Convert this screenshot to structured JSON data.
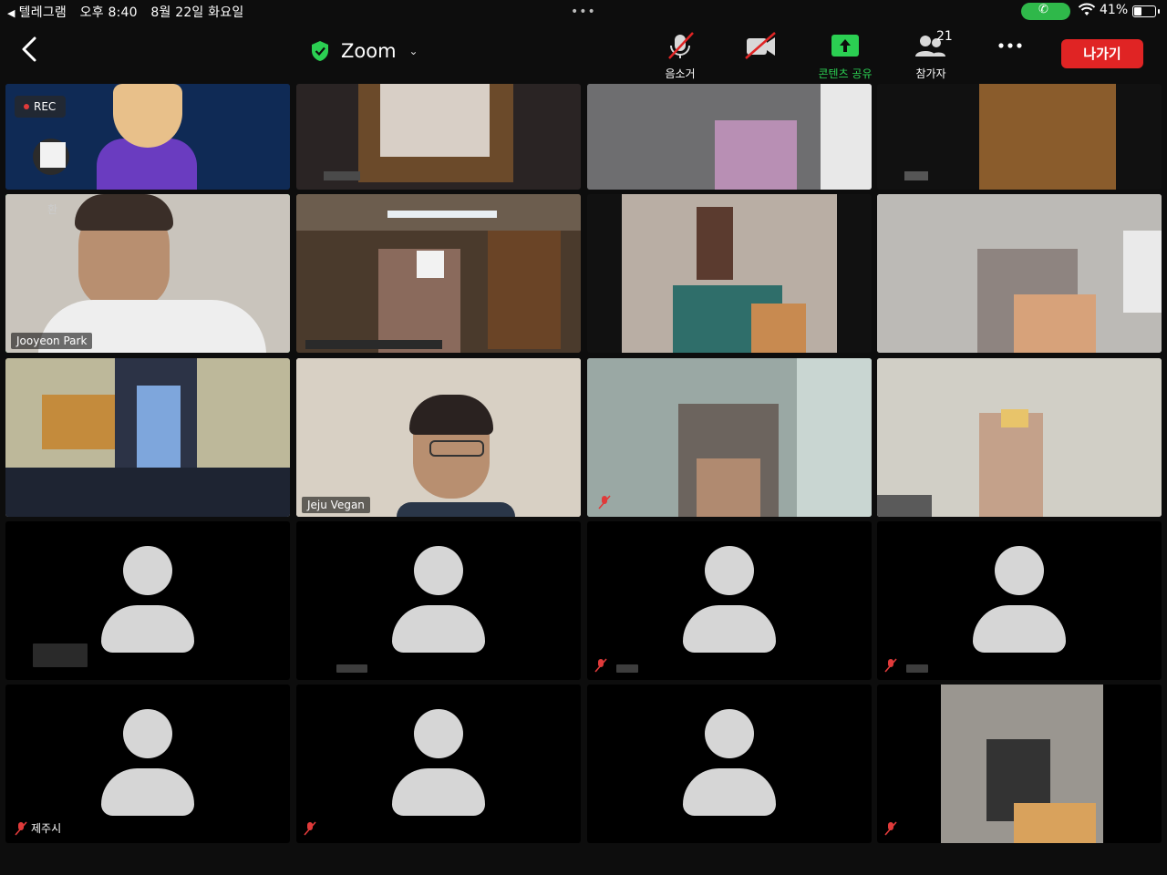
{
  "status_bar": {
    "back_app": "텔레그램",
    "time": "오후 8:40",
    "date": "8월 22일 화요일",
    "dots": "•••",
    "battery_pct": "41%",
    "battery_level": 0.41,
    "accent_call": "#2fb84a"
  },
  "toolbar": {
    "title": "Zoom",
    "tools": [
      {
        "label": "음소거 ",
        "icon": "mic-off-icon"
      },
      {
        "label": "",
        "icon": "video-off-icon"
      },
      {
        "label": "콘텐츠 공유",
        "icon": "share-content-icon"
      },
      {
        "label": "참가자",
        "icon": "participants-icon",
        "count": "21"
      },
      {
        "label": "",
        "icon": "more-icon"
      }
    ],
    "leave_label": "나가기",
    "leave_color": "#e02424",
    "accent_green": "#2bcf52"
  },
  "recording": {
    "label": "REC"
  },
  "participants": [
    {
      "name": "Jooyeon Park"
    },
    {
      "name": "Jeju Vegan"
    },
    {
      "name": "제주시"
    }
  ],
  "cut_label": "환"
}
